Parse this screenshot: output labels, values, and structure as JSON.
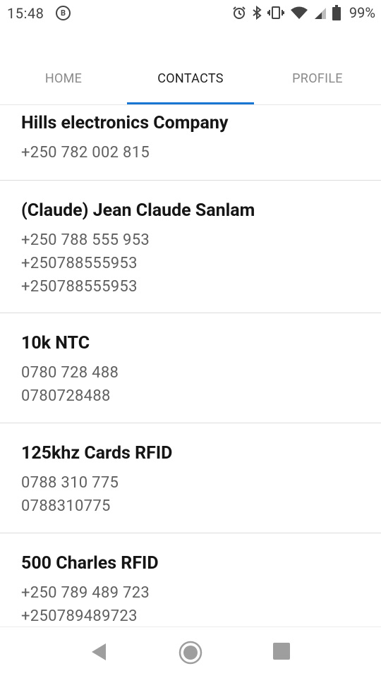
{
  "status_bar": {
    "time": "15:48",
    "notification_badge": "B",
    "battery_percent": "99%",
    "icons": [
      "alarm-icon",
      "bluetooth-icon",
      "vibrate-icon",
      "wifi-icon",
      "signal-icon",
      "battery-icon"
    ]
  },
  "tabs": [
    {
      "label": "HOME",
      "active": false
    },
    {
      "label": "CONTACTS",
      "active": true
    },
    {
      "label": "PROFILE",
      "active": false
    }
  ],
  "accent_color": "#1976d2",
  "contacts": [
    {
      "name": "Hills electronics Company",
      "phones": [
        "+250 782 002 815"
      ]
    },
    {
      "name": "(Claude) Jean Claude Sanlam",
      "phones": [
        "+250 788 555 953",
        "+250788555953",
        "+250788555953"
      ]
    },
    {
      "name": "10k NTC",
      "phones": [
        "0780 728 488",
        "0780728488"
      ]
    },
    {
      "name": "125khz Cards RFID",
      "phones": [
        "0788 310 775",
        "0788310775"
      ]
    },
    {
      "name": "500 Charles RFID",
      "phones": [
        "+250 789 489 723",
        "+250789489723"
      ]
    }
  ],
  "nav": [
    "back-icon",
    "home-icon",
    "recents-icon"
  ]
}
